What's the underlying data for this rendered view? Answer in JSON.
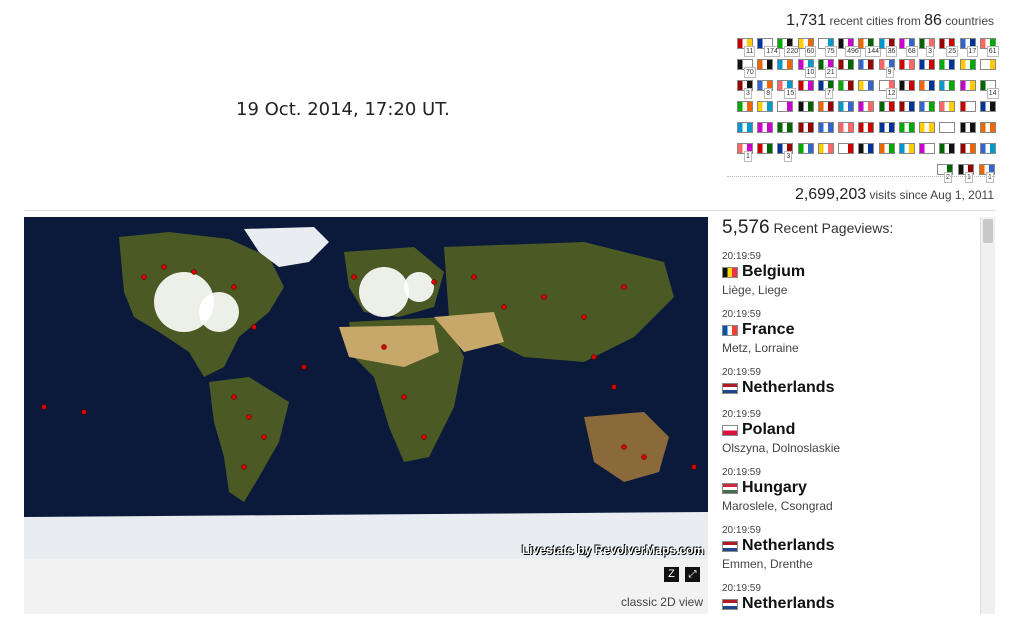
{
  "timestamp": "19 Oct. 2014, 17:20 UT.",
  "summary": {
    "cities": "1,731",
    "cities_text": "recent cities from",
    "countries": "86",
    "countries_text": "countries"
  },
  "flags": [
    [
      "11",
      "174",
      "220",
      "60",
      "75",
      "496",
      "144",
      "36",
      "68",
      "3",
      "25",
      "17",
      "61"
    ],
    [
      "70",
      "",
      "",
      "10",
      "21",
      "",
      "",
      "9",
      "",
      "",
      "",
      "",
      ""
    ],
    [
      "3",
      "8",
      "15",
      "",
      "7",
      "",
      "",
      "12",
      "",
      "",
      "",
      "",
      "14"
    ],
    [
      "",
      "",
      "",
      "",
      "",
      "",
      "",
      "",
      "",
      "",
      "",
      "",
      ""
    ],
    [
      "",
      "",
      "",
      "",
      "",
      "",
      "",
      "",
      "",
      "",
      "",
      "",
      ""
    ],
    [
      "1",
      "",
      "3",
      "",
      "",
      "",
      "",
      "",
      "",
      "",
      "",
      "",
      ""
    ],
    [
      "2",
      "1",
      "1"
    ]
  ],
  "visits": {
    "count": "2,699,203",
    "text": "visits since Aug 1, 2011"
  },
  "map": {
    "watermark": "Livestats by RevolverMaps.com",
    "zoom_label": "Z",
    "fullscreen_label": "⤢",
    "classic_link": "classic 2D view"
  },
  "feed": {
    "count": "5,576",
    "title": "Recent Pageviews:",
    "entries": [
      {
        "time": "20:19:59",
        "country": "Belgium",
        "place": "Liège, Liege"
      },
      {
        "time": "20:19:59",
        "country": "France",
        "place": "Metz, Lorraine"
      },
      {
        "time": "20:19:59",
        "country": "Netherlands",
        "place": ""
      },
      {
        "time": "20:19:59",
        "country": "Poland",
        "place": "Olszyna, Dolnoslaskie"
      },
      {
        "time": "20:19:59",
        "country": "Hungary",
        "place": "Maroslele, Csongrad"
      },
      {
        "time": "20:19:59",
        "country": "Netherlands",
        "place": "Emmen, Drenthe"
      },
      {
        "time": "20:19:59",
        "country": "Netherlands",
        "place": ""
      }
    ]
  },
  "colors": {
    "ocean": "#0b1a3a",
    "land": "#4b5a24",
    "desert": "#c8a86a",
    "ice": "#e9edf2",
    "dot": "#d90000",
    "cluster": "#ffffff"
  }
}
